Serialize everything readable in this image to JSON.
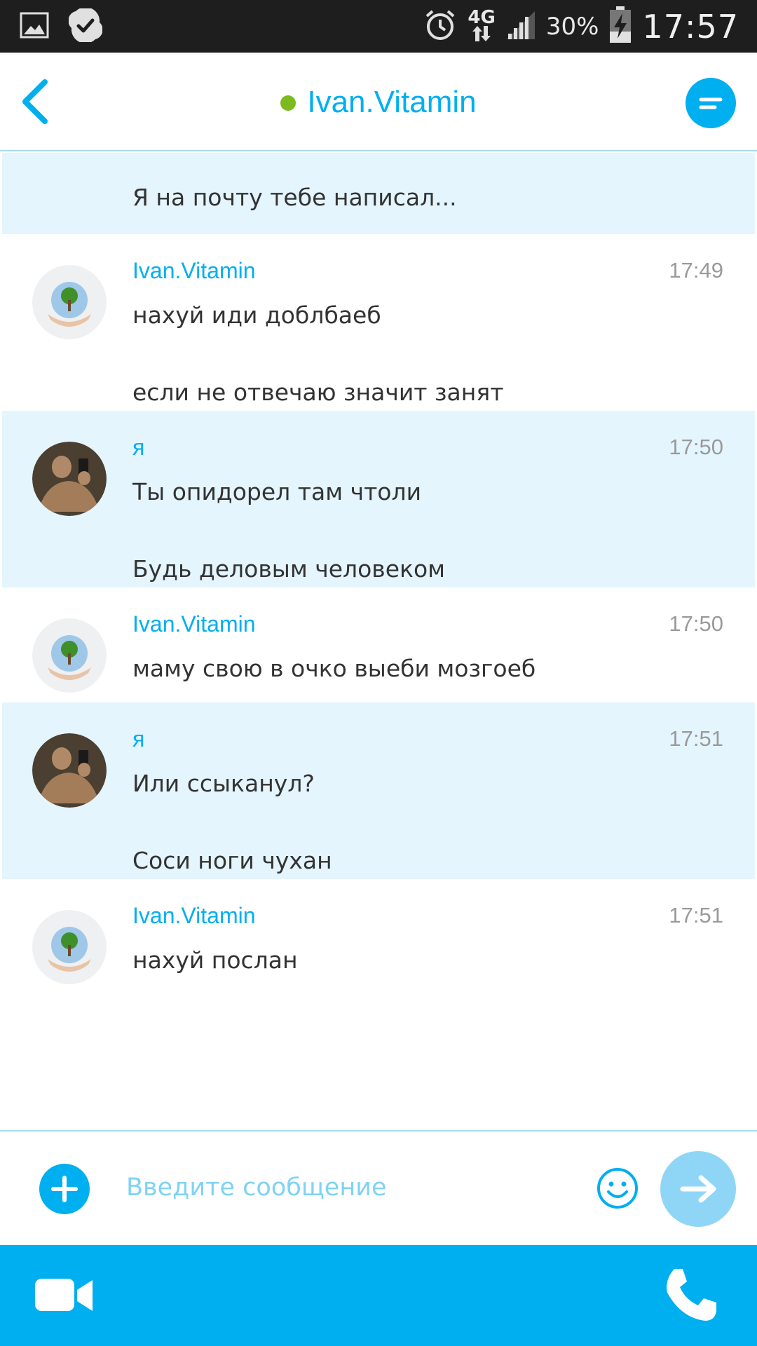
{
  "status_bar": {
    "time": "17:57",
    "battery_percent": "30%",
    "network": "4G",
    "icons": [
      "gallery-icon",
      "skype-check-icon",
      "alarm-icon",
      "network-arrows-icon",
      "signal-icon",
      "battery-charging-icon"
    ]
  },
  "header": {
    "contact_name": "Ivan.Vitamin",
    "status_color": "#7cba1f",
    "accent_color": "#00aff0"
  },
  "messages": [
    {
      "sender": "",
      "time": "",
      "mine": true,
      "lines": [
        "Я на почту тебе написал..."
      ]
    },
    {
      "sender": "Ivan.Vitamin",
      "time": "17:49",
      "mine": false,
      "lines": [
        "нахуй иди доблбаеб",
        "если не отвечаю значит занят"
      ]
    },
    {
      "sender": "я",
      "time": "17:50",
      "mine": true,
      "lines": [
        "Ты опидорел там чтоли",
        "Будь деловым человеком"
      ]
    },
    {
      "sender": "Ivan.Vitamin",
      "time": "17:50",
      "mine": false,
      "lines": [
        "маму свою в очко выеби мозгоеб"
      ]
    },
    {
      "sender": "я",
      "time": "17:51",
      "mine": true,
      "lines": [
        "Или ссыканул?",
        "Соси ноги чухан"
      ]
    },
    {
      "sender": "Ivan.Vitamin",
      "time": "17:51",
      "mine": false,
      "lines": [
        "нахуй послан"
      ]
    }
  ],
  "composer": {
    "placeholder": "Введите сообщение"
  }
}
